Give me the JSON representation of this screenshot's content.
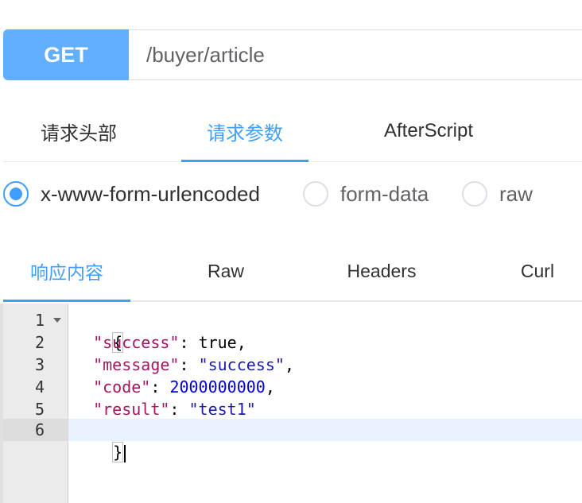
{
  "request": {
    "method": "GET",
    "url": "/buyer/article"
  },
  "request_tabs": [
    {
      "label": "请求头部",
      "active": false
    },
    {
      "label": "请求参数",
      "active": true
    },
    {
      "label": "AfterScript",
      "active": false
    }
  ],
  "body_types": [
    {
      "label": "x-www-form-urlencoded",
      "checked": true
    },
    {
      "label": "form-data",
      "checked": false
    },
    {
      "label": "raw",
      "checked": false
    }
  ],
  "response_tabs": [
    {
      "label": "响应内容",
      "active": true
    },
    {
      "label": "Raw",
      "active": false
    },
    {
      "label": "Headers",
      "active": false
    },
    {
      "label": "Curl",
      "active": false
    }
  ],
  "editor": {
    "line_numbers": [
      "1",
      "2",
      "3",
      "4",
      "5",
      "6"
    ],
    "active_line": "6",
    "lines": [
      {
        "open": "{"
      },
      {
        "key": "\"success\"",
        "sep": ": ",
        "value": "true",
        "value_type": "bool",
        "trail": ","
      },
      {
        "key": "\"message\"",
        "sep": ": ",
        "value": "\"success\"",
        "value_type": "str",
        "trail": ","
      },
      {
        "key": "\"code\"",
        "sep": ": ",
        "value": "2000000000",
        "value_type": "num",
        "trail": ","
      },
      {
        "key": "\"result\"",
        "sep": ": ",
        "value": "\"test1\"",
        "value_type": "str",
        "trail": ""
      },
      {
        "close": "}"
      }
    ]
  },
  "colors": {
    "method_bg": "#61affe",
    "accent": "#409eff",
    "json_key": "#a31560",
    "json_string": "#1a1aa6",
    "json_number": "#0000cd"
  },
  "icons": {
    "fold": "chevron-down-icon"
  }
}
